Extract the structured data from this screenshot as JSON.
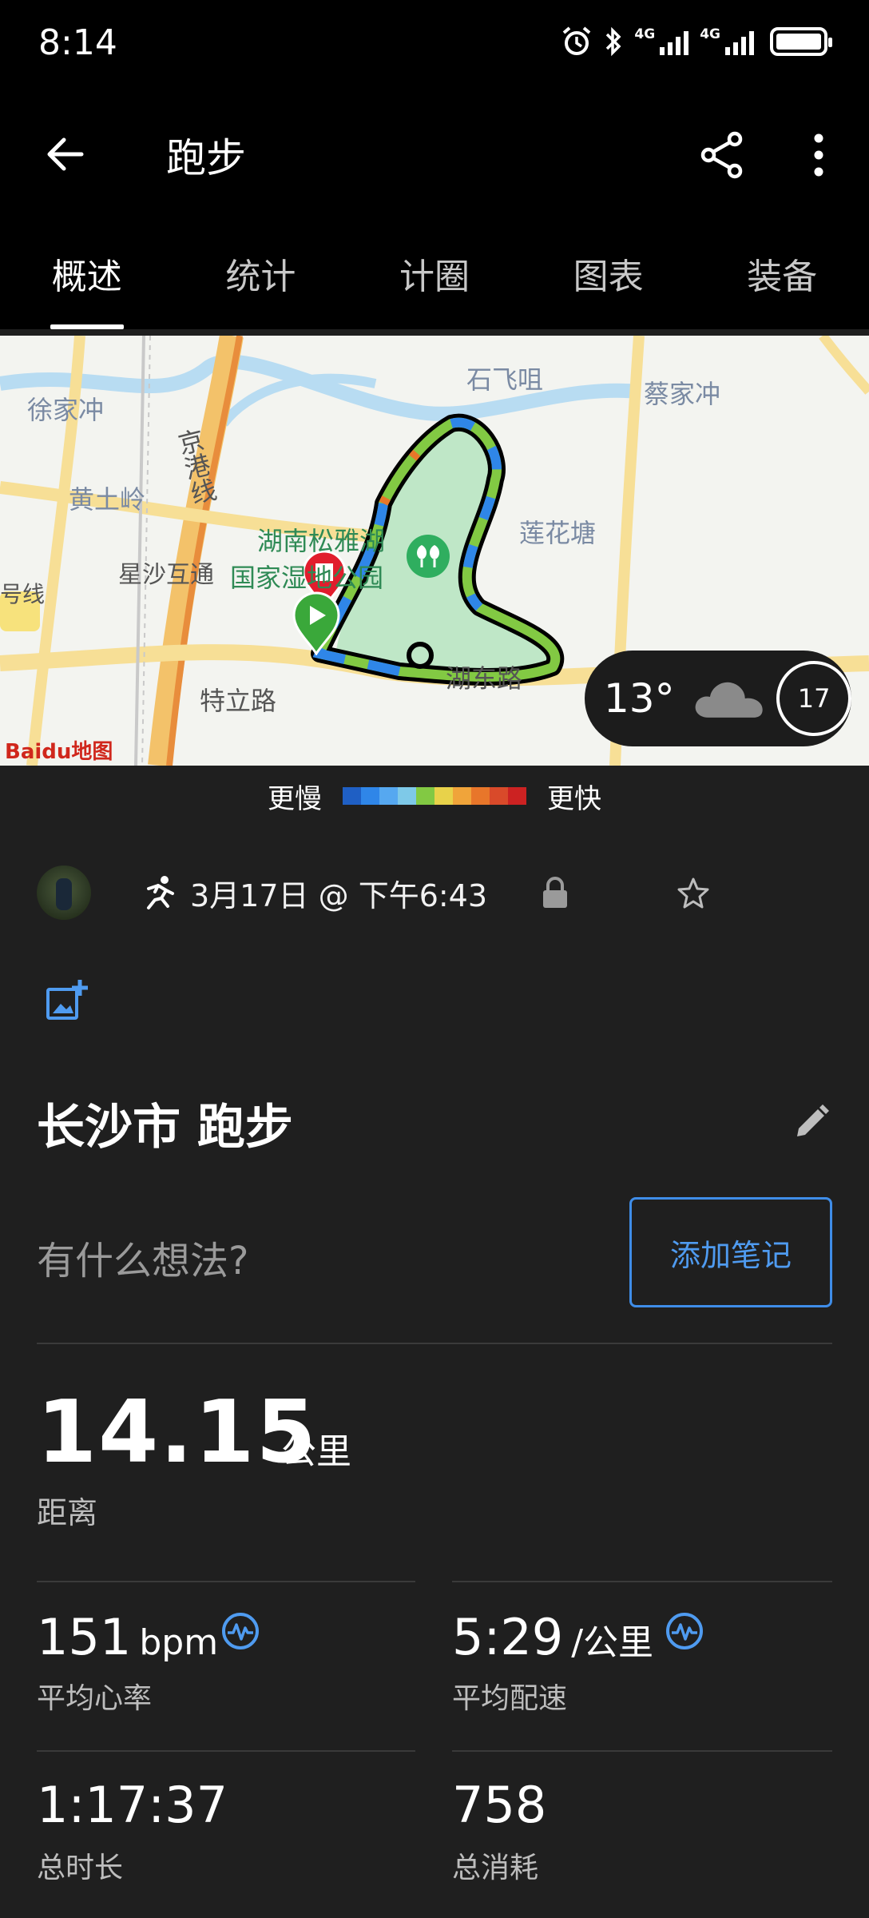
{
  "status_bar": {
    "time": "8:14",
    "network_1": "4G",
    "network_2": "4G"
  },
  "app_bar": {
    "title": "跑步",
    "back_icon": "arrow-left-icon",
    "share_icon": "share-icon",
    "more_icon": "more-vert-icon"
  },
  "tabs": [
    {
      "label": "概述",
      "active": true
    },
    {
      "label": "统计",
      "active": false
    },
    {
      "label": "计圈",
      "active": false
    },
    {
      "label": "图表",
      "active": false
    },
    {
      "label": "装备",
      "active": false
    }
  ],
  "map": {
    "labels": {
      "xujiachong": "徐家冲",
      "shifeiju": "石飞咀",
      "caijiachong": "蔡家冲",
      "huangtuling": "黄土岭",
      "jinggangxian": "京港线",
      "lianhuatang": "莲花塘",
      "xingsha_interchange": "星沙互通",
      "park_line1": "湖南松雅湖",
      "park_line2": "国家湿地公园",
      "hao_xian": "号线",
      "telilu": "特立路",
      "hu_dong_lu": "湖东路",
      "baidu": "Baidu地图"
    },
    "weather": {
      "temperature": "13°",
      "icon": "cloud-icon",
      "uv": "17"
    },
    "route_colors": [
      "#1f5fc4",
      "#2f86e8",
      "#56a8f0",
      "#7ec9e8",
      "#82c943",
      "#e8d24a",
      "#f0a43a",
      "#e8762a",
      "#d94a2a",
      "#cc2222"
    ]
  },
  "legend": {
    "slower": "更慢",
    "faster": "更快"
  },
  "activity": {
    "date": "3月17日 @ 下午6:43",
    "title": "长沙市 跑步",
    "notes_prompt": "有什么想法?",
    "add_note": "添加笔记"
  },
  "stats": {
    "distance": {
      "value": "14.15",
      "unit": "公里",
      "label": "距离"
    },
    "heart_rate": {
      "value": "151",
      "unit": "bpm",
      "label": "平均心率"
    },
    "pace": {
      "value": "5:29",
      "unit": "/公里",
      "label": "平均配速"
    },
    "duration": {
      "value": "1:17:37",
      "label": "总时长"
    },
    "calories": {
      "value": "758",
      "label": "总消耗"
    }
  }
}
